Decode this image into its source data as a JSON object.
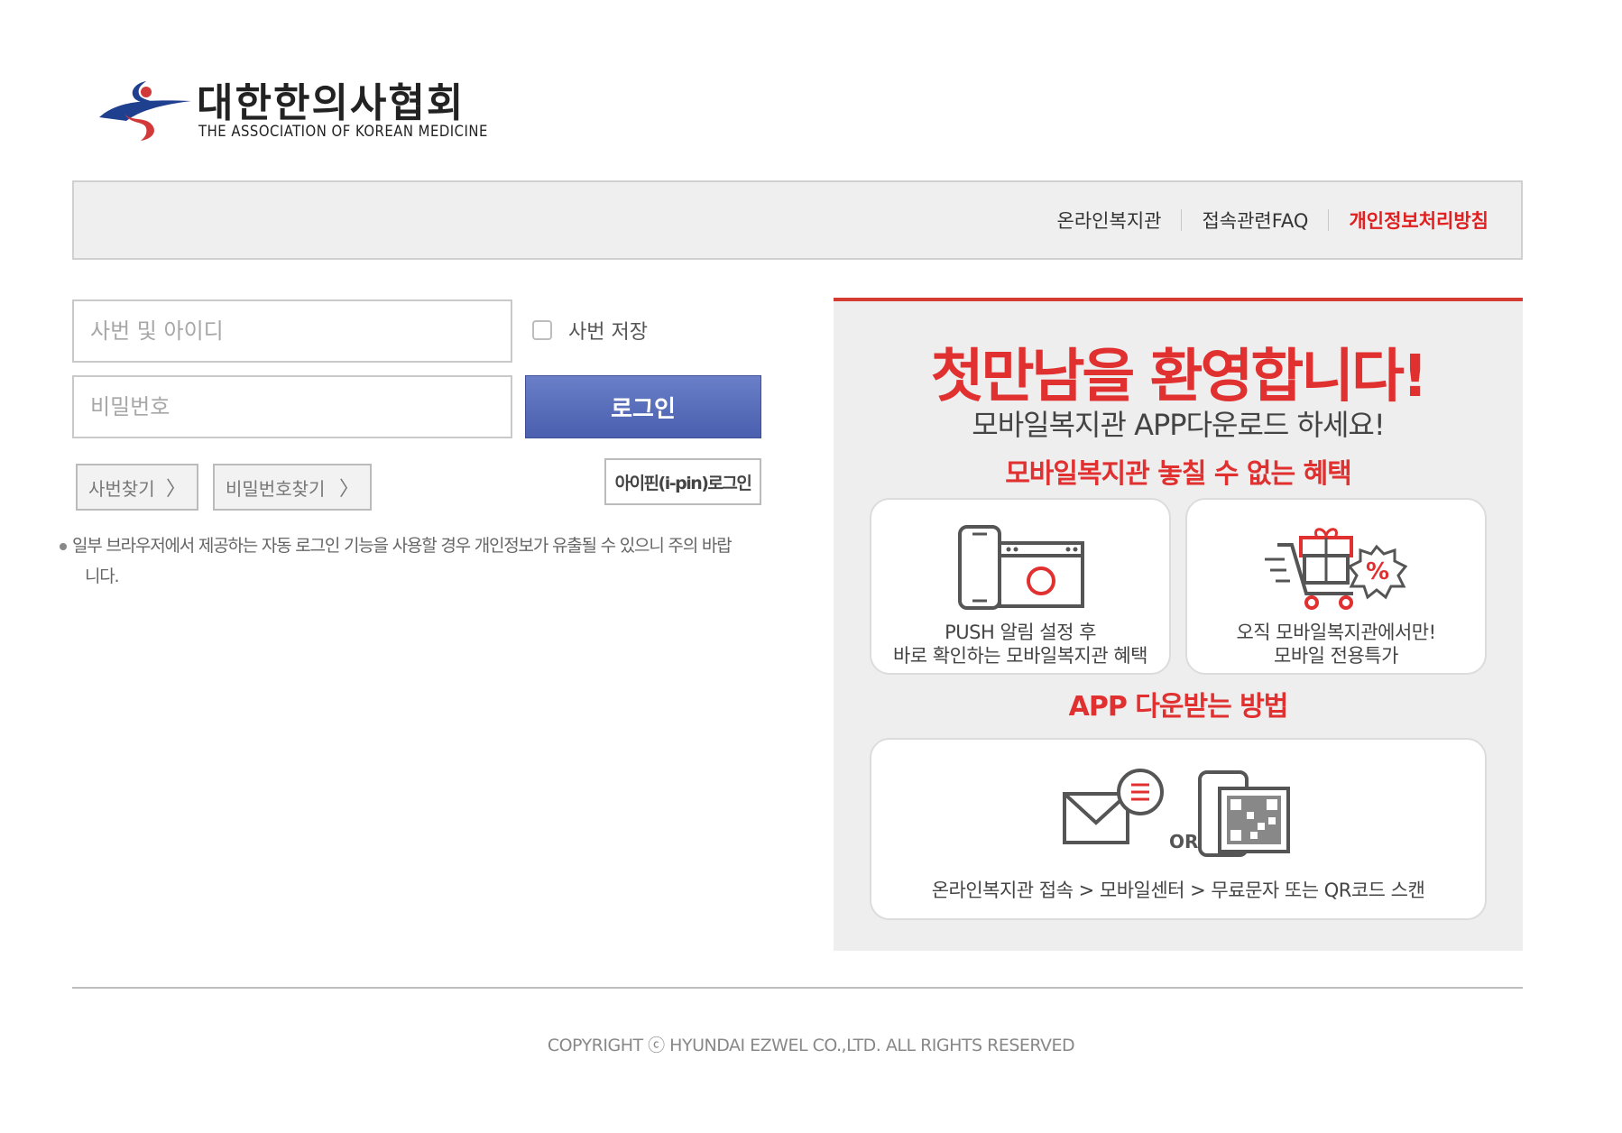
{
  "logo": {
    "name_ko": "대한한의사협회",
    "name_en": "THE ASSOCIATION OF KOREAN MEDICINE",
    "colors": {
      "blue": "#1f3f8f",
      "red": "#d23a3a"
    }
  },
  "topnav": {
    "items": [
      {
        "label": "온라인복지관",
        "active": false
      },
      {
        "label": "접속관련FAQ",
        "active": false
      },
      {
        "label": "개인정보처리방침",
        "active": true
      }
    ],
    "active_color": "#e02020"
  },
  "login": {
    "id_placeholder": "사번 및 아이디",
    "id_value": "",
    "pw_placeholder": "비밀번호",
    "pw_value": "",
    "save_label": "사번 저장",
    "save_checked": false,
    "login_button": "로그인",
    "find_id": "사번찾기",
    "find_pw": "비밀번호찾기",
    "ipin_button": "아이핀(i-pin)로그인",
    "notice_line1": "일부 브라우저에서 제공하는 자동 로그인 기능을 사용할 경우 개인정보가 유출될 수 있으니 주의 바랍",
    "notice_line2": "니다.",
    "button_color": "#5a6fbf"
  },
  "promo": {
    "title": "첫만남을 환영합니다!",
    "subtitle": "모바일복지관 APP다운로드 하세요!",
    "benefit_heading": "모바일복지관 놓칠 수 없는 혜택",
    "card1": {
      "icon": "phone-browser-icon",
      "line1": "PUSH 알림 설정 후",
      "line2": "바로 확인하는 모바일복지관 혜택"
    },
    "card2": {
      "icon": "gift-cart-discount-icon",
      "line1": "오직 모바일복지관에서만!",
      "line2": "모바일 전용특가"
    },
    "how_heading": "APP 다운받는 방법",
    "card3": {
      "icon_left": "message-envelope-icon",
      "or": "OR",
      "icon_right": "phone-qr-icon",
      "steps": "온라인복지관 접속 > 모바일센터 > 무료문자 또는 QR코드 스캔"
    },
    "accent_color": "#e03030",
    "panel_bg": "#eeeeee"
  },
  "footer": {
    "copyright": "COPYRIGHT ⓒ HYUNDAI EZWEL CO.,LTD. ALL RIGHTS RESERVED"
  }
}
